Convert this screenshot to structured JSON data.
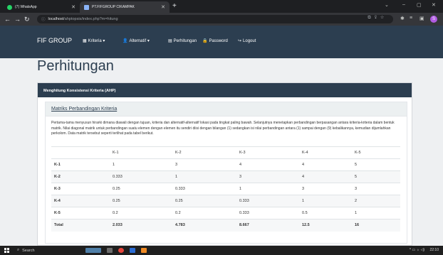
{
  "browser": {
    "tabs": [
      {
        "label": "(7) WhatsApp",
        "favicon_color": "#25d366"
      },
      {
        "label": "PT.FIFGROUP CIKAMPAK",
        "favicon_color": "#8ab4f8"
      }
    ],
    "new_tab": "+",
    "url_host": "localhost",
    "url_path": "/ahptopsis/index.php?m=hitung",
    "window_controls": [
      "⌄",
      "–",
      "▢",
      "✕"
    ]
  },
  "nav": {
    "brand": "FIF GROUP",
    "items": [
      {
        "icon": "▦",
        "label": "Kriteria ▾"
      },
      {
        "icon": "👤",
        "label": "Alternatif ▾"
      },
      {
        "icon": "▤",
        "label": "Perhitungan"
      },
      {
        "icon": "🔒",
        "label": "Password"
      },
      {
        "icon": "↪",
        "label": "Logout"
      }
    ]
  },
  "page": {
    "title": "Perhitungan",
    "card_header": "Menghitung Konsistensi Kriteria (AHP)",
    "subcard_title": "Matriks Perbandingan Kriteria",
    "paragraph": "Pertama-tama menyusun hirarki dimana diawali dengan tujuan, kriteria dan alternatif-alternatif lokasi pada tingkat paling bawah. Selanjutnya menetapkan perbandingan berpasangan antara kriteria-kriteria dalam bentuk matrik. Nilai diagonal matrik untuk perbandingan suatu elemen dengan elemen itu sendiri diisi dengan bilangan (1) sedangkan isi nilai perbandingan antara (1) sampai dengan (9) kebalikannya, kemudian dijumlahkan perkolom. Data matrik tersebut seperti terlihat pada tabel berikut."
  },
  "matrix": {
    "headers": [
      "",
      "K-1",
      "K-2",
      "K-3",
      "K-4",
      "K-5"
    ],
    "rows": [
      [
        "K-1",
        "1",
        "3",
        "4",
        "4",
        "5"
      ],
      [
        "K-2",
        "0.333",
        "1",
        "3",
        "4",
        "5"
      ],
      [
        "K-3",
        "0.25",
        "0.333",
        "1",
        "3",
        "3"
      ],
      [
        "K-4",
        "0.25",
        "0.25",
        "0.333",
        "1",
        "2"
      ],
      [
        "K-5",
        "0.2",
        "0.2",
        "0.333",
        "0.5",
        "1"
      ],
      [
        "Total",
        "2.033",
        "4.783",
        "8.667",
        "12.5",
        "16"
      ]
    ]
  },
  "taskbar": {
    "search_placeholder": "Search",
    "time": "22:10",
    "tray": "^ ▭ ☼ ◁)"
  },
  "colors": {
    "navbar": "#2c3e50",
    "page_bg": "#eef0f2",
    "card_header": "#2c3e50"
  }
}
